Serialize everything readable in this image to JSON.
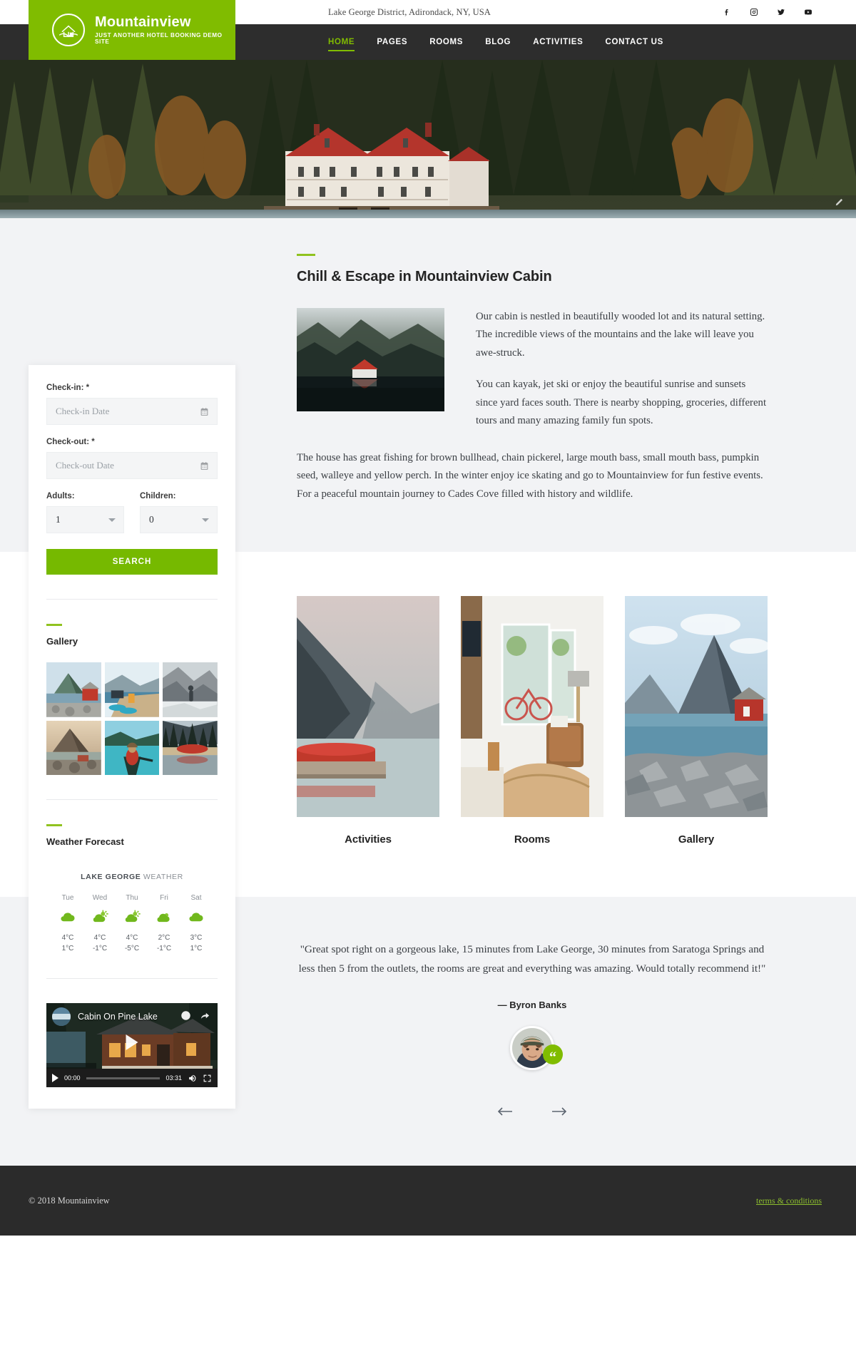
{
  "topbar": {
    "address": "Lake George District, Adirondack, NY, USA",
    "social": [
      {
        "name": "facebook-icon",
        "label": "Facebook"
      },
      {
        "name": "instagram-icon",
        "label": "Instagram"
      },
      {
        "name": "twitter-icon",
        "label": "Twitter"
      },
      {
        "name": "youtube-icon",
        "label": "YouTube"
      }
    ]
  },
  "brand": {
    "name": "Mountainview",
    "tagline": "JUST ANOTHER HOTEL BOOKING DEMO SITE",
    "logo_icon": "cabin-in-circle-logo",
    "color": "#80bc00"
  },
  "nav": {
    "items": [
      {
        "label": "HOME",
        "active": true
      },
      {
        "label": "PAGES",
        "active": false
      },
      {
        "label": "ROOMS",
        "active": false
      },
      {
        "label": "BLOG",
        "active": false
      },
      {
        "label": "ACTIVITIES",
        "active": false
      },
      {
        "label": "CONTACT US",
        "active": false
      }
    ]
  },
  "booking": {
    "checkin_label": "Check-in:",
    "checkin_required": "*",
    "checkin_placeholder": "Check-in Date",
    "checkin_value": "",
    "checkout_label": "Check-out:",
    "checkout_required": "*",
    "checkout_placeholder": "Check-out Date",
    "checkout_value": "",
    "adults_label": "Adults:",
    "adults_value": "1",
    "children_label": "Children:",
    "children_value": "0",
    "search_label": "SEARCH"
  },
  "gallery_widget": {
    "title": "Gallery",
    "items": [
      {
        "alt": "red-cabin-by-fjord"
      },
      {
        "alt": "dock-with-kayaks"
      },
      {
        "alt": "hiker-on-snowy-ridge"
      },
      {
        "alt": "mountain-at-sunset"
      },
      {
        "alt": "woman-in-canoe-on-lake"
      },
      {
        "alt": "red-canoe-on-dock"
      }
    ]
  },
  "weather": {
    "title": "Weather Forecast",
    "location_bold": "LAKE GEORGE",
    "location_rest": " WEATHER",
    "days": [
      {
        "name": "Tue",
        "icon": "cloud",
        "high": "4°C",
        "low": "1°C"
      },
      {
        "name": "Wed",
        "icon": "sun-cloud",
        "high": "4°C",
        "low": "-1°C"
      },
      {
        "name": "Thu",
        "icon": "sun-cloud",
        "high": "4°C",
        "low": "-5°C"
      },
      {
        "name": "Fri",
        "icon": "cloud-small-sun",
        "high": "2°C",
        "low": "-1°C"
      },
      {
        "name": "Sat",
        "icon": "cloud",
        "high": "3°C",
        "low": "1°C"
      }
    ]
  },
  "video": {
    "title": "Cabin On Pine Lake",
    "current_time": "00:00",
    "duration": "03:31",
    "watch_later_icon": "clock-icon",
    "share_icon": "share-icon",
    "play_icon": "play-icon",
    "volume_icon": "volume-icon",
    "fullscreen_icon": "fullscreen-icon"
  },
  "main": {
    "title": "Chill & Escape in Mountainview Cabin",
    "image_alt": "foggy-forest-lake-cabin",
    "para1": "Our cabin is nestled in beautifully wooded lot and its natural setting. The incredible views of the mountains and the lake will leave you awe-struck.",
    "para2": "You can kayak, jet ski or enjoy the beautiful sunrise and sunsets since yard faces south. There is nearby shopping, groceries, different tours and many amazing family fun spots.",
    "para3": "The house has great fishing for brown bullhead, chain pickerel, large mouth bass, small mouth bass, pumpkin seed, walleye and yellow perch. In the winter enjoy ice skating and go to Mountainview for fun festive events. For a peaceful mountain journey to Cades Cove filled with history and wildlife."
  },
  "cards": [
    {
      "label": "Activities",
      "alt": "red-canoes-on-dock-mountain-lake"
    },
    {
      "label": "Rooms",
      "alt": "bright-living-room-with-bicycle"
    },
    {
      "label": "Gallery",
      "alt": "red-cabin-rocky-shore-mountain"
    }
  ],
  "testimonial": {
    "quote": "\"Great spot right on a gorgeous lake, 15 minutes from Lake George, 30 minutes from Saratoga Springs and less then 5 from the outlets, the rooms are great and everything was amazing. Would totally recommend it!\"",
    "author": "— Byron Banks",
    "avatar_alt": "portrait-of-young-man-in-cap",
    "quote_badge": "“",
    "prev_label": "Previous testimonial",
    "next_label": "Next testimonial"
  },
  "footer": {
    "copyright": "© 2018 Mountainview",
    "terms": "terms & conditions"
  }
}
